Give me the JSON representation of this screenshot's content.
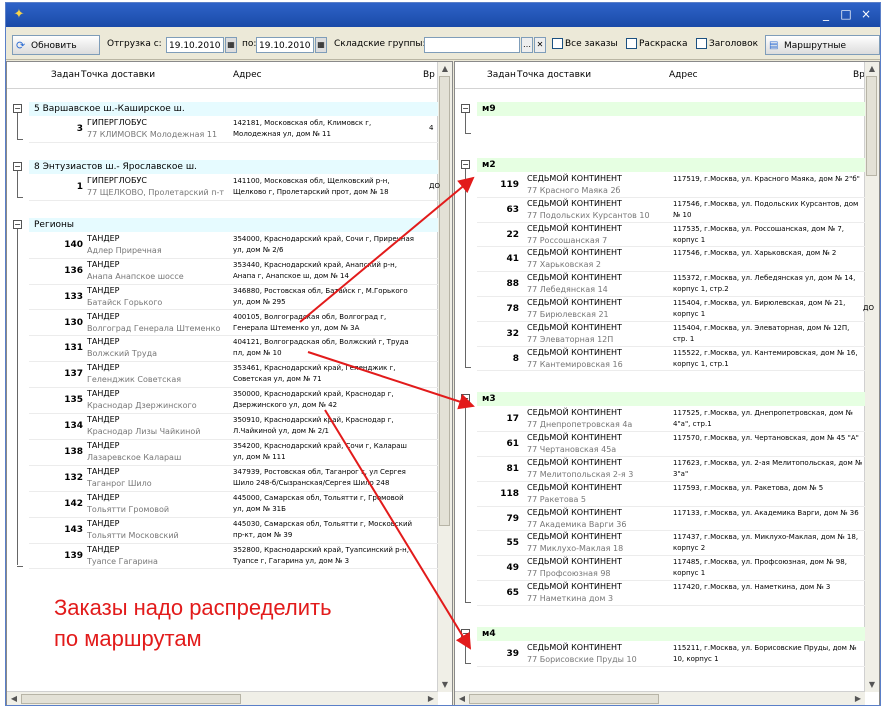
{
  "window": {
    "controls": [
      "_",
      "□",
      "×"
    ]
  },
  "toolbar": {
    "refresh_label": "Обновить",
    "shipment_from_label": "Отгрузка с:",
    "date_from": "19.10.2010",
    "to_label": "по:",
    "date_to": "19.10.2010",
    "warehouse_label": "Складские группы:",
    "warehouse_value": "",
    "all_orders_label": "Все заказы",
    "coloring_label": "Раскраска",
    "title_label": "Заголовок",
    "route_sheets_label": "Маршрутные листы"
  },
  "left_panel": {
    "headers": {
      "order": "Задан",
      "point": "Точка доставки",
      "address": "Адрес",
      "time": "Вр"
    },
    "groups": [
      {
        "title": "5 Варшавское ш.-Каширское ш.",
        "rows": [
          {
            "num": "3",
            "name": "ГИПЕРГЛОБУС",
            "sub": "77 КЛИМОВСК Молодежная 11",
            "addr": "142181, Московская обл, Климовск г, Молодежная ул, дом № 11",
            "extra": "4"
          }
        ]
      },
      {
        "title": "8 Энтузиастов ш.- Ярославское ш.",
        "rows": [
          {
            "num": "1",
            "name": "ГИПЕРГЛОБУС",
            "sub": "77 ЩЕЛКОВО, Пролетарский п-т",
            "addr": "141100, Московская обл, Щелковский р-н, Щелково г, Пролетарский прот, дом № 18",
            "extra": "ДО"
          }
        ]
      },
      {
        "title": "Регионы",
        "rows": [
          {
            "num": "140",
            "name": "ТАНДЕР",
            "sub": "Адлер Приречная",
            "addr": "354000, Краснодарский край, Сочи г, Приречная ул, дом № 2/6",
            "extra": ""
          },
          {
            "num": "136",
            "name": "ТАНДЕР",
            "sub": "Анапа Анапское шоссе",
            "addr": "353440, Краснодарский край, Анапский р-н, Анапа г, Анапское ш, дом № 14",
            "extra": ""
          },
          {
            "num": "133",
            "name": "ТАНДЕР",
            "sub": "Батайск Горького",
            "addr": "346880, Ростовская обл, Батайск г, М.Горького ул, дом № 295",
            "extra": ""
          },
          {
            "num": "130",
            "name": "ТАНДЕР",
            "sub": "Волгоград Генерала Штеменко",
            "addr": "400105, Волгоградская обл, Волгоград г, Генерала Штеменко ул, дом № 3А",
            "extra": ""
          },
          {
            "num": "131",
            "name": "ТАНДЕР",
            "sub": "Волжский Труда",
            "addr": "404121, Волгоградская обл, Волжский г, Труда пл, дом № 10",
            "extra": ""
          },
          {
            "num": "137",
            "name": "ТАНДЕР",
            "sub": "Геленджик Советская",
            "addr": "353461, Краснодарский край, Геленджик г, Советская ул, дом № 71",
            "extra": ""
          },
          {
            "num": "135",
            "name": "ТАНДЕР",
            "sub": "Краснодар Дзержинского",
            "addr": "350000, Краснодарский край, Краснодар г, Дзержинского ул, дом № 42",
            "extra": ""
          },
          {
            "num": "134",
            "name": "ТАНДЕР",
            "sub": "Краснодар Лизы Чайкиной",
            "addr": "350910, Краснодарский край, Краснодар г, Л.Чайкиной ул, дом № 2/1",
            "extra": ""
          },
          {
            "num": "138",
            "name": "ТАНДЕР",
            "sub": "Лазаревское Калараш",
            "addr": "354200, Краснодарский край, Сочи г, Калараш ул, дом № 111",
            "extra": ""
          },
          {
            "num": "132",
            "name": "ТАНДЕР",
            "sub": "Таганрог Шило",
            "addr": "347939, Ростовская обл, Таганрог г, ул Сергея Шило 248-б/Сызранская/Сергея Шило 248",
            "extra": ""
          },
          {
            "num": "142",
            "name": "ТАНДЕР",
            "sub": "Тольятти Громовой",
            "addr": "445000, Самарская обл, Тольятти г, Громовой ул, дом № 31Б",
            "extra": ""
          },
          {
            "num": "143",
            "name": "ТАНДЕР",
            "sub": "Тольятти Московский",
            "addr": "445030, Самарская обл, Тольятти г, Московский пр-кт, дом № 39",
            "extra": ""
          },
          {
            "num": "139",
            "name": "ТАНДЕР",
            "sub": "Туапсе Гагарина",
            "addr": "352800, Краснодарский край, Туапсинский р-н, Туапсе г, Гагарина ул, дом № 3",
            "extra": ""
          }
        ]
      }
    ]
  },
  "right_panel": {
    "headers": {
      "order": "Задан",
      "point": "Точка доставки",
      "address": "Адрес",
      "time": "Вр"
    },
    "groups": [
      {
        "title": "м9",
        "rows": []
      },
      {
        "title": "м2",
        "rows": [
          {
            "num": "119",
            "name": "СЕДЬМОЙ КОНТИНЕНТ",
            "sub": "77 Красного Маяка 2б",
            "addr": "117519, г.Москва, ул. Красного Маяка, дом № 2\"б\"",
            "extra": ""
          },
          {
            "num": "63",
            "name": "СЕДЬМОЙ КОНТИНЕНТ",
            "sub": "77 Подольских Курсантов 10",
            "addr": "117546, г.Москва, ул. Подольских Курсантов, дом № 10",
            "extra": ""
          },
          {
            "num": "22",
            "name": "СЕДЬМОЙ КОНТИНЕНТ",
            "sub": "77 Россошанская 7",
            "addr": "117535, г.Москва, ул. Россошанская, дом № 7, корпус 1",
            "extra": ""
          },
          {
            "num": "41",
            "name": "СЕДЬМОЙ КОНТИНЕНТ",
            "sub": "77 Харьковская 2",
            "addr": "117546, г.Москва, ул. Харьковская, дом № 2",
            "extra": ""
          },
          {
            "num": "88",
            "name": "СЕДЬМОЙ КОНТИНЕНТ",
            "sub": "77 Лебедянская 14",
            "addr": "115372, г.Москва, ул. Лебедянская ул, дом № 14, корпус 1, стр.2",
            "extra": ""
          },
          {
            "num": "78",
            "name": "СЕДЬМОЙ КОНТИНЕНТ",
            "sub": "77 Бирюлевская 21",
            "addr": "115404, г.Москва, ул. Бирюлевская, дом № 21, корпус 1",
            "extra": "ДО"
          },
          {
            "num": "32",
            "name": "СЕДЬМОЙ КОНТИНЕНТ",
            "sub": "77 Элеваторная 12П",
            "addr": "115404, г.Москва, ул. Элеваторная, дом № 12П, стр. 1",
            "extra": ""
          },
          {
            "num": "8",
            "name": "СЕДЬМОЙ КОНТИНЕНТ",
            "sub": "77 Кантемировская 16",
            "addr": "115522, г.Москва, ул. Кантемировская, дом № 16, корпус 1, стр.1",
            "extra": ""
          }
        ]
      },
      {
        "title": "м3",
        "rows": [
          {
            "num": "17",
            "name": "СЕДЬМОЙ КОНТИНЕНТ",
            "sub": "77 Днепропетровская 4а",
            "addr": "117525, г.Москва, ул. Днепропетровская, дом № 4\"а\", стр.1",
            "extra": ""
          },
          {
            "num": "61",
            "name": "СЕДЬМОЙ КОНТИНЕНТ",
            "sub": "77 Чертановская 45а",
            "addr": "117570, г.Москва, ул. Чертановская, дом № 45 \"А\"",
            "extra": ""
          },
          {
            "num": "81",
            "name": "СЕДЬМОЙ КОНТИНЕНТ",
            "sub": "77 Мелитопольская 2-я 3",
            "addr": "117623, г.Москва, ул. 2-ая Мелитопольская, дом № 3\"а\"",
            "extra": ""
          },
          {
            "num": "118",
            "name": "СЕДЬМОЙ КОНТИНЕНТ",
            "sub": "77 Ракетова 5",
            "addr": "117593, г.Москва, ул. Ракетова, дом № 5",
            "extra": ""
          },
          {
            "num": "79",
            "name": "СЕДЬМОЙ КОНТИНЕНТ",
            "sub": "77 Академика Варги 36",
            "addr": "117133, г.Москва, ул. Академика Варги, дом № 36",
            "extra": ""
          },
          {
            "num": "55",
            "name": "СЕДЬМОЙ КОНТИНЕНТ",
            "sub": "77 Миклухо-Маклая 18",
            "addr": "117437, г.Москва, ул. Миклухо-Маклая, дом № 18, корпус 2",
            "extra": ""
          },
          {
            "num": "49",
            "name": "СЕДЬМОЙ КОНТИНЕНТ",
            "sub": "77 Профсоюзная 98",
            "addr": "117485, г.Москва, ул. Профсоюзная, дом № 98, корпус 1",
            "extra": ""
          },
          {
            "num": "65",
            "name": "СЕДЬМОЙ КОНТИНЕНТ",
            "sub": "77 Наметкина дом 3",
            "addr": "117420, г.Москва, ул. Наметкина, дом № 3",
            "extra": ""
          }
        ]
      },
      {
        "title": "м4",
        "rows": [
          {
            "num": "39",
            "name": "СЕДЬМОЙ КОНТИНЕНТ",
            "sub": "77 Борисовские Пруды 10",
            "addr": "115211, г.Москва, ул. Борисовские Пруды, дом № 10, корпус 1",
            "extra": ""
          }
        ]
      }
    ]
  },
  "annotation": {
    "line1": "Заказы надо распределить",
    "line2": "по маршрутам"
  },
  "colors": {
    "titlebar": "#1a4aa8",
    "group_left": "#e6fbff",
    "group_right": "#e6ffe2",
    "annotation": "#e21b1b"
  }
}
